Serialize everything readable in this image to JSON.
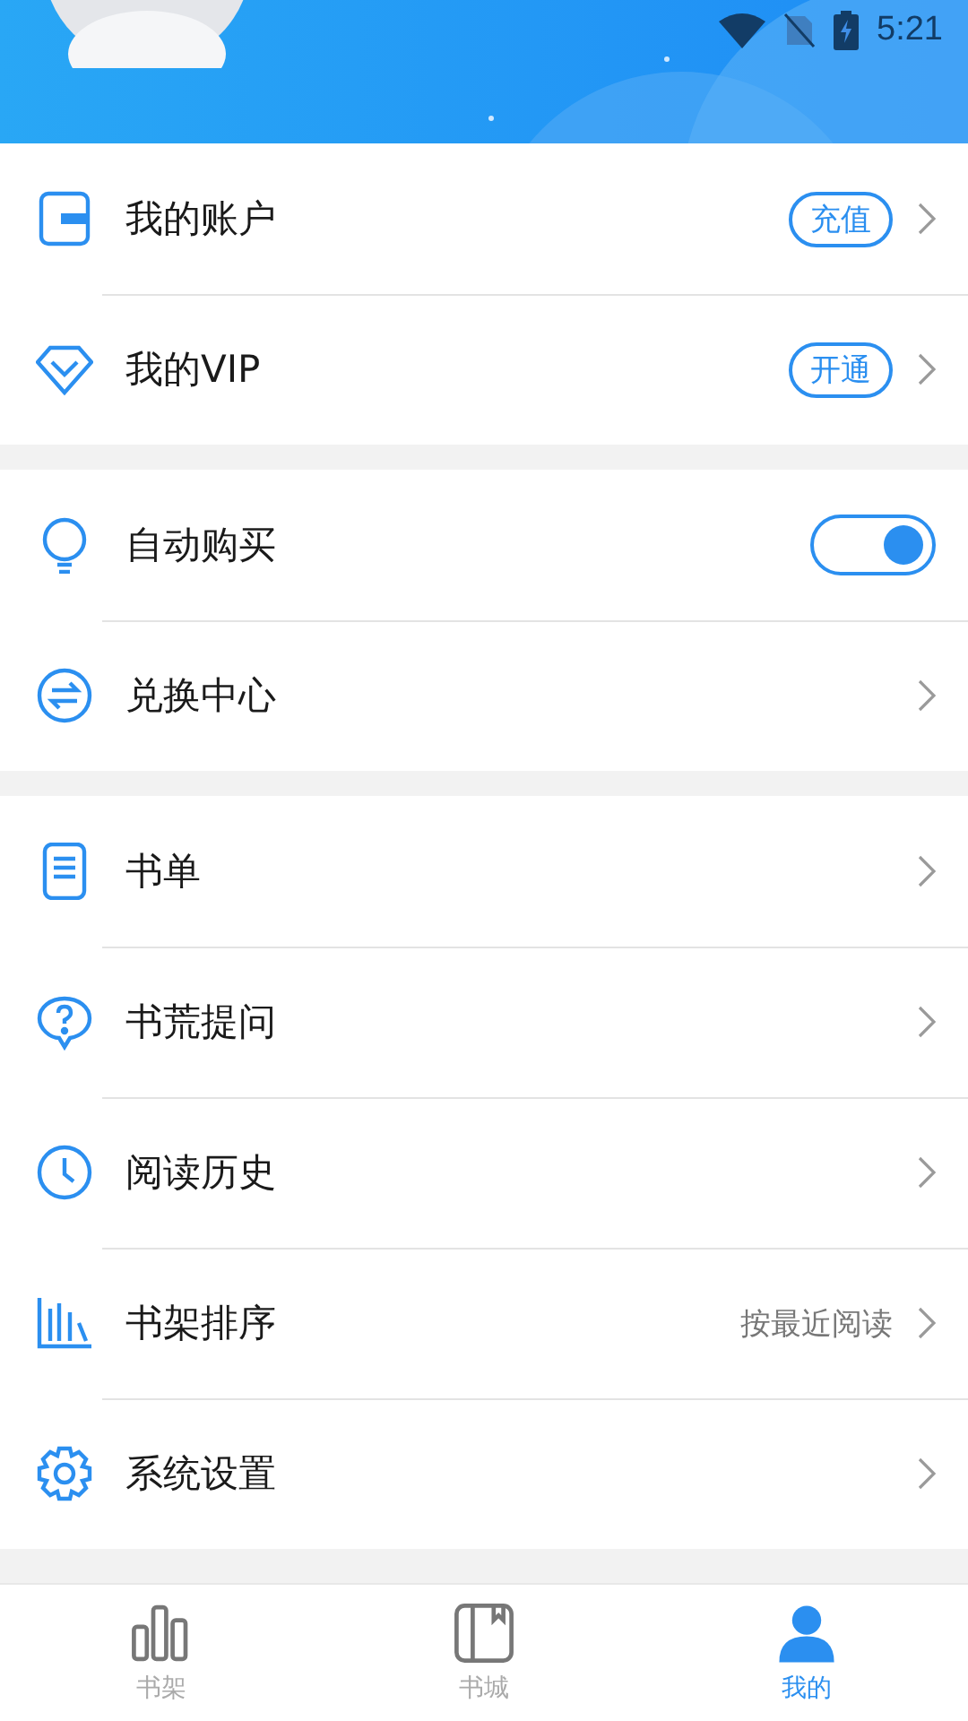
{
  "status_bar": {
    "time": "5:21"
  },
  "sections": [
    {
      "rows": [
        {
          "kind": "badge",
          "label": "我的账户",
          "badge": "充值"
        },
        {
          "kind": "badge",
          "label": "我的VIP",
          "badge": "开通"
        }
      ]
    },
    {
      "rows": [
        {
          "kind": "toggle",
          "label": "自动购买",
          "on": true
        },
        {
          "kind": "link",
          "label": "兑换中心"
        }
      ]
    },
    {
      "rows": [
        {
          "kind": "link",
          "label": "书单"
        },
        {
          "kind": "link",
          "label": "书荒提问"
        },
        {
          "kind": "link",
          "label": "阅读历史"
        },
        {
          "kind": "value",
          "label": "书架排序",
          "value": "按最近阅读"
        },
        {
          "kind": "link",
          "label": "系统设置"
        }
      ]
    }
  ],
  "tabs": [
    {
      "label": "书架",
      "selected": false
    },
    {
      "label": "书城",
      "selected": false
    },
    {
      "label": "我的",
      "selected": true
    }
  ]
}
